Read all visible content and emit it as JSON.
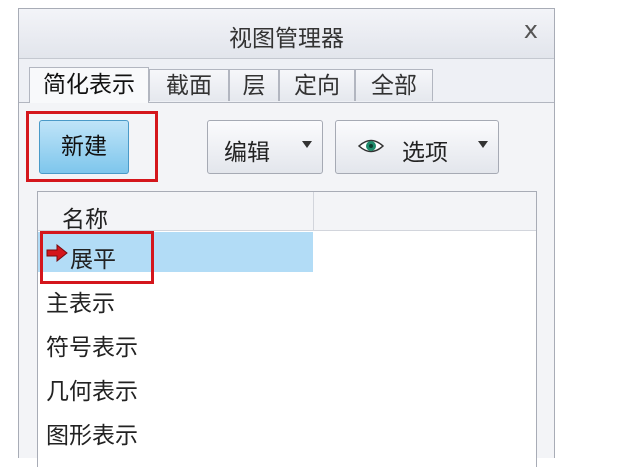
{
  "window": {
    "title": "视图管理器",
    "close_glyph": "x"
  },
  "tabs": [
    {
      "label": "简化表示",
      "active": true
    },
    {
      "label": "截面",
      "active": false
    },
    {
      "label": "层",
      "active": false
    },
    {
      "label": "定向",
      "active": false
    },
    {
      "label": "全部",
      "active": false
    }
  ],
  "toolbar": {
    "new_label": "新建",
    "edit_label": "编辑",
    "options_label": "选项"
  },
  "list": {
    "column_header": "名称",
    "rows": [
      {
        "label": "展平",
        "selected": true,
        "icon": "red-arrow-icon"
      },
      {
        "label": "主表示",
        "selected": false
      },
      {
        "label": "符号表示",
        "selected": false
      },
      {
        "label": "几何表示",
        "selected": false
      },
      {
        "label": "图形表示",
        "selected": false
      }
    ]
  },
  "colors": {
    "highlight": "#d4161c",
    "selection": "#b2dcf6",
    "new_button": "#7ec6ec"
  }
}
